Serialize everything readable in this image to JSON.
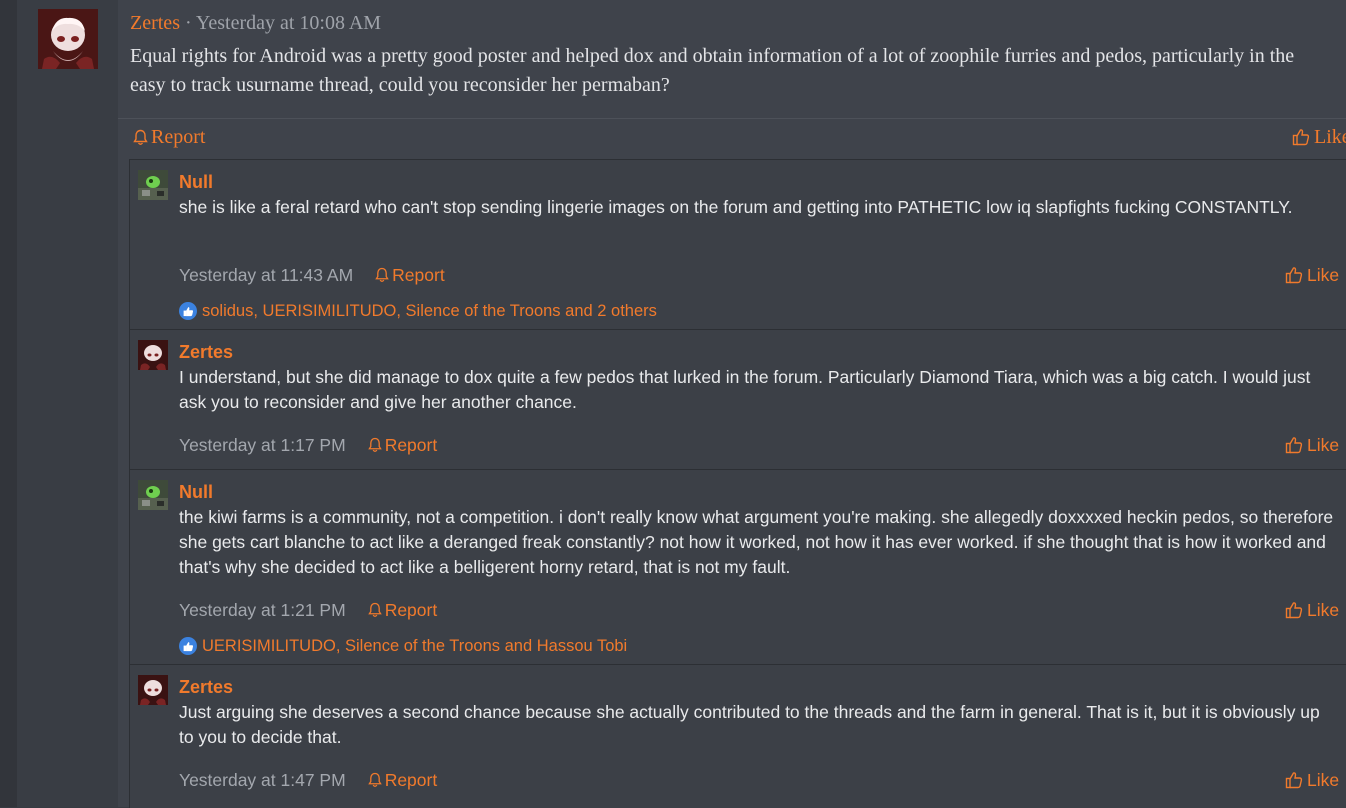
{
  "post": {
    "author": "Zertes",
    "separator": " · ",
    "timestamp": "Yesterday at 10:08 AM",
    "body": "Equal rights for Android was a pretty good poster and helped dox and obtain information of a lot of zoophile furries and pedos, particularly in the easy to track usurname thread, could you reconsider her permaban?",
    "report_label": "Report",
    "like_label": "Like"
  },
  "comments": [
    {
      "author": "Null",
      "text": "she is like a feral retard who can't stop sending lingerie images on the forum and getting into PATHETIC low iq slapfights fucking CONSTANTLY.",
      "timestamp": "Yesterday at 11:43 AM",
      "report_label": "Report",
      "like_label": "Like",
      "reactions": "solidus, UERISIMILITUDO, Silence of the Troons and 2 others"
    },
    {
      "author": "Zertes",
      "text": "I understand, but she did manage to dox quite a few pedos that lurked in the forum. Particularly Diamond Tiara, which was a big catch. I would just ask you to reconsider and give her another chance.",
      "timestamp": "Yesterday at 1:17 PM",
      "report_label": "Report",
      "like_label": "Like"
    },
    {
      "author": "Null",
      "text": "the kiwi farms is a community, not a competition. i don't really know what argument you're making. she allegedly doxxxxed heckin pedos, so therefore she gets cart blanche to act like a deranged freak constantly? not how it worked, not how it has ever worked. if she thought that is how it worked and that's why she decided to act like a belligerent horny retard, that is not my fault.",
      "timestamp": "Yesterday at 1:21 PM",
      "report_label": "Report",
      "like_label": "Like",
      "reactions": "UERISIMILITUDO, Silence of the Troons and Hassou Tobi"
    },
    {
      "author": "Zertes",
      "text": "Just arguing she deserves a second chance because she actually contributed to the threads and the farm in general. That is it, but it is obviously up to you to decide that.",
      "timestamp": "Yesterday at 1:47 PM",
      "report_label": "Report",
      "like_label": "Like"
    }
  ],
  "colors": {
    "accent": "#f17a2c",
    "text": "#e9eaec",
    "muted": "#a3a7ae",
    "reaction_badge": "#3b82e0"
  }
}
